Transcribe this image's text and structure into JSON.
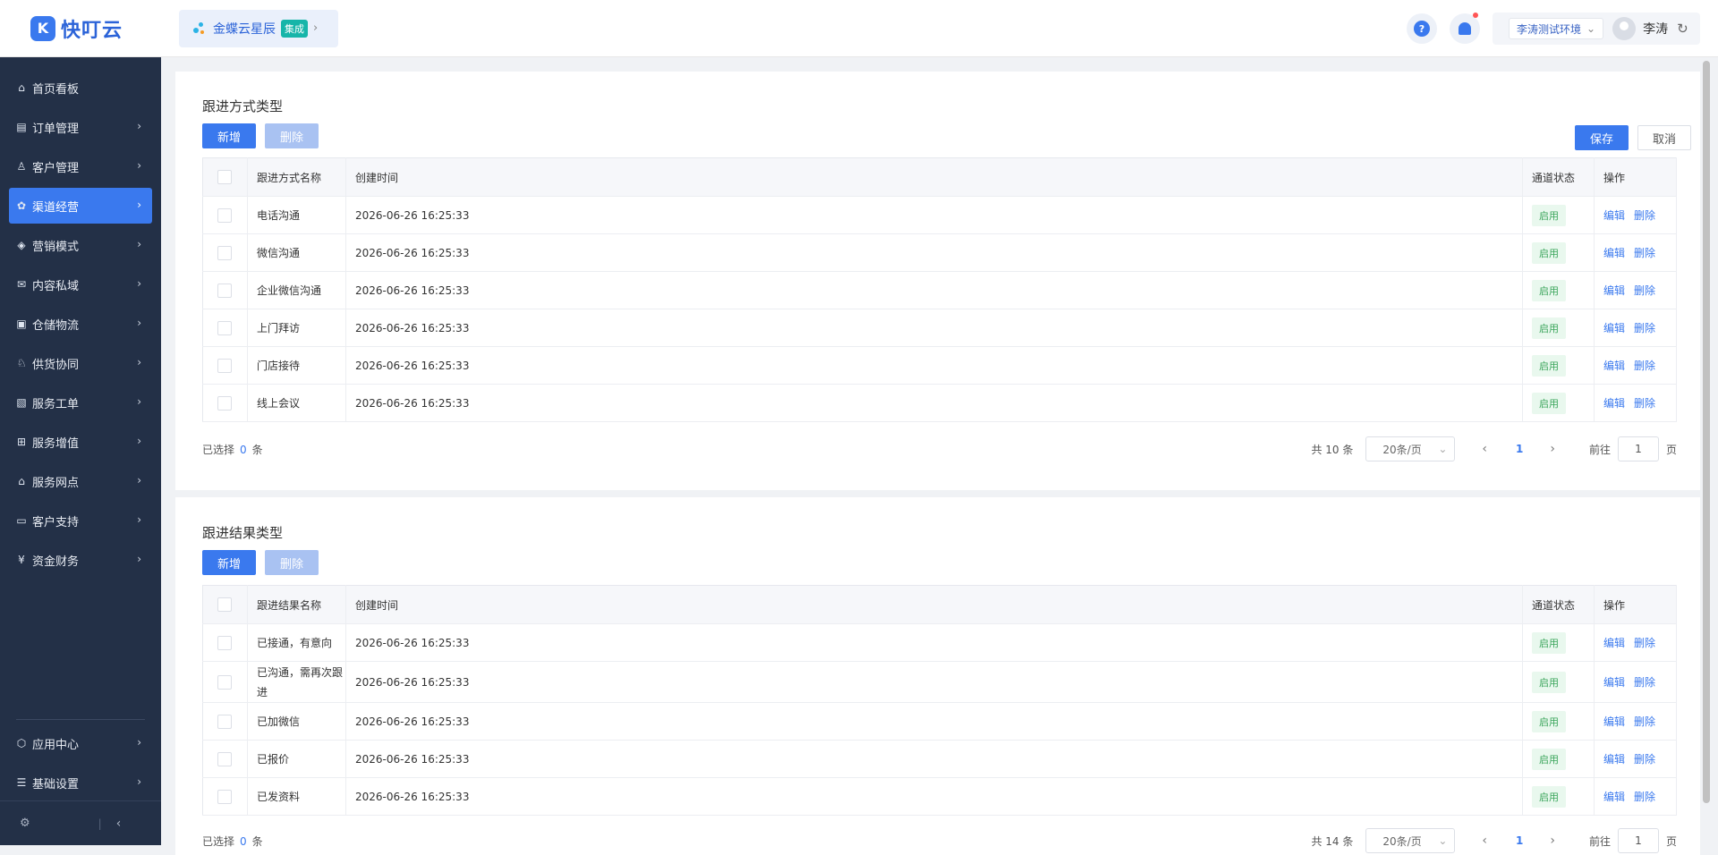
{
  "app": {
    "logo_text": "快叮云",
    "logo_mark": "K"
  },
  "header": {
    "kingdee_text": "金蝶云星辰",
    "kingdee_badge": "集成",
    "help_label": "?",
    "env_select": "李涛测试环境",
    "user_name": "李涛"
  },
  "sidebar": {
    "items": [
      {
        "label": "首页看板",
        "icon": "home-icon"
      },
      {
        "label": "订单管理",
        "icon": "order-icon"
      },
      {
        "label": "客户管理",
        "icon": "user-icon"
      },
      {
        "label": "渠道经营",
        "icon": "channel-icon",
        "active": true
      },
      {
        "label": "营销模式",
        "icon": "tag-icon"
      },
      {
        "label": "内容私域",
        "icon": "mail-icon"
      },
      {
        "label": "仓储物流",
        "icon": "box-icon"
      },
      {
        "label": "供货协同",
        "icon": "supplier-icon"
      },
      {
        "label": "服务工单",
        "icon": "ticket-icon"
      },
      {
        "label": "服务增值",
        "icon": "bag-icon"
      },
      {
        "label": "服务网点",
        "icon": "store-icon"
      },
      {
        "label": "客户支持",
        "icon": "support-icon"
      },
      {
        "label": "资金财务",
        "icon": "yen-icon"
      }
    ],
    "bottom_items": [
      {
        "label": "应用中心",
        "icon": "cube-icon"
      },
      {
        "label": "基础设置",
        "icon": "settings-icon"
      }
    ]
  },
  "section1": {
    "title": "跟进方式类型",
    "add_label": "新增",
    "delete_label": "删除",
    "save_label": "保存",
    "cancel_label": "取消",
    "columns": [
      "跟进方式名称",
      "创建时间",
      "通道状态",
      "操作"
    ],
    "rows": [
      {
        "name": "电话沟通",
        "time": "2026-06-26 16:25:33",
        "status": "启用"
      },
      {
        "name": "微信沟通",
        "time": "2026-06-26 16:25:33",
        "status": "启用"
      },
      {
        "name": "企业微信沟通",
        "time": "2026-06-26 16:25:33",
        "status": "启用"
      },
      {
        "name": "上门拜访",
        "time": "2026-06-26 16:25:33",
        "status": "启用"
      },
      {
        "name": "门店接待",
        "time": "2026-06-26 16:25:33",
        "status": "启用"
      },
      {
        "name": "线上会议",
        "time": "2026-06-26 16:25:33",
        "status": "启用"
      }
    ],
    "edit_label": "编辑",
    "row_delete_label": "删除",
    "selected_prefix": "已选择",
    "selected_count": "0",
    "selected_suffix": "条",
    "total": "共 10 条",
    "page_size": "20条/页",
    "current_page": "1",
    "goto_label": "前往",
    "goto_value": "1",
    "page_unit": "页"
  },
  "section2": {
    "title": "跟进结果类型",
    "add_label": "新增",
    "delete_label": "删除",
    "columns": [
      "跟进结果名称",
      "创建时间",
      "通道状态",
      "操作"
    ],
    "rows": [
      {
        "name": "已接通，有意向",
        "time": "2026-06-26 16:25:33",
        "status": "启用"
      },
      {
        "name": "已沟通，需再次跟进",
        "time": "2026-06-26 16:25:33",
        "status": "启用"
      },
      {
        "name": "已加微信",
        "time": "2026-06-26 16:25:33",
        "status": "启用"
      },
      {
        "name": "已报价",
        "time": "2026-06-26 16:25:33",
        "status": "启用"
      },
      {
        "name": "已发资料",
        "time": "2026-06-26 16:25:33",
        "status": "启用"
      }
    ],
    "edit_label": "编辑",
    "row_delete_label": "删除",
    "selected_prefix": "已选择",
    "selected_count": "0",
    "selected_suffix": "条",
    "total": "共 14 条",
    "page_size": "20条/页",
    "current_page": "1",
    "goto_label": "前往",
    "goto_value": "1",
    "page_unit": "页"
  },
  "colors": {
    "accent": "#3a79ee",
    "sidebar_bg": "#233047",
    "status_green": "#3aa55b"
  }
}
